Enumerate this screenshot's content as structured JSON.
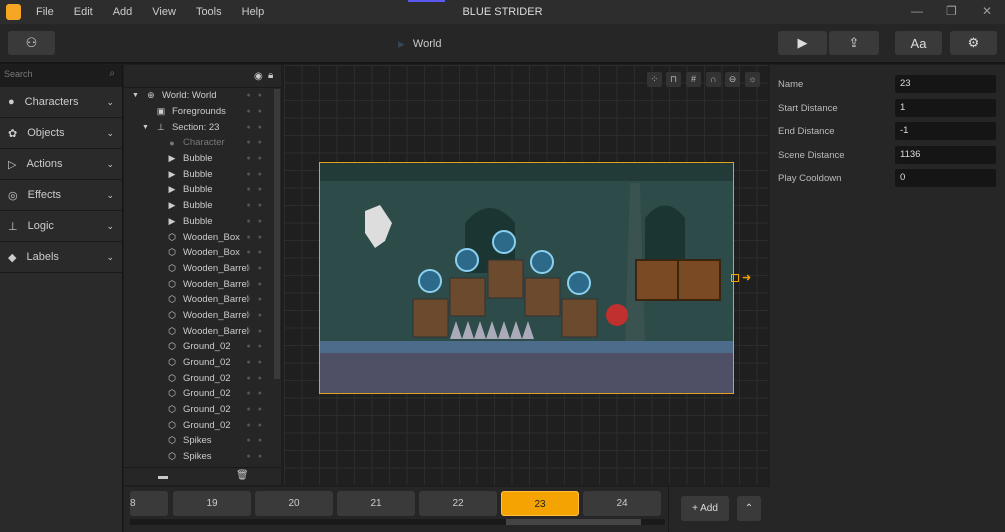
{
  "app": {
    "title": "BLUE STRIDER",
    "menu": [
      "File",
      "Edit",
      "Add",
      "View",
      "Tools",
      "Help"
    ]
  },
  "toolbar": {
    "breadcrumb": "World",
    "font_label": "Aa"
  },
  "sidebar": {
    "search_placeholder": "Search",
    "categories": [
      "Characters",
      "Objects",
      "Actions",
      "Effects",
      "Logic",
      "Labels"
    ]
  },
  "tree": {
    "items": [
      {
        "label": "World: World",
        "icon": "globe-icon",
        "indent": 0,
        "arrow": true
      },
      {
        "label": "Foregrounds",
        "icon": "image-icon",
        "indent": 1,
        "arrow": false
      },
      {
        "label": "Section: 23",
        "icon": "stamp-icon",
        "indent": 1,
        "arrow": true
      },
      {
        "label": "Character",
        "icon": "person-icon",
        "indent": 2,
        "dim": true
      },
      {
        "label": "Bubble",
        "icon": "play-icon",
        "indent": 2
      },
      {
        "label": "Bubble",
        "icon": "play-icon",
        "indent": 2
      },
      {
        "label": "Bubble",
        "icon": "play-icon",
        "indent": 2
      },
      {
        "label": "Bubble",
        "icon": "play-icon",
        "indent": 2
      },
      {
        "label": "Bubble",
        "icon": "play-icon",
        "indent": 2
      },
      {
        "label": "Wooden_Box",
        "icon": "hexagon-icon",
        "indent": 2
      },
      {
        "label": "Wooden_Box",
        "icon": "hexagon-icon",
        "indent": 2
      },
      {
        "label": "Wooden_Barrel",
        "icon": "hexagon-icon",
        "indent": 2
      },
      {
        "label": "Wooden_Barrel",
        "icon": "hexagon-icon",
        "indent": 2
      },
      {
        "label": "Wooden_Barrel",
        "icon": "hexagon-icon",
        "indent": 2
      },
      {
        "label": "Wooden_Barrel",
        "icon": "hexagon-icon",
        "indent": 2
      },
      {
        "label": "Wooden_Barrel",
        "icon": "hexagon-icon",
        "indent": 2
      },
      {
        "label": "Ground_02",
        "icon": "hexagon-icon",
        "indent": 2
      },
      {
        "label": "Ground_02",
        "icon": "hexagon-icon",
        "indent": 2
      },
      {
        "label": "Ground_02",
        "icon": "hexagon-icon",
        "indent": 2
      },
      {
        "label": "Ground_02",
        "icon": "hexagon-icon",
        "indent": 2
      },
      {
        "label": "Ground_02",
        "icon": "hexagon-icon",
        "indent": 2
      },
      {
        "label": "Ground_02",
        "icon": "hexagon-icon",
        "indent": 2
      },
      {
        "label": "Spikes",
        "icon": "hexagon-icon",
        "indent": 2
      },
      {
        "label": "Spikes",
        "icon": "hexagon-icon",
        "indent": 2
      }
    ]
  },
  "properties": [
    {
      "label": "Name",
      "value": "23"
    },
    {
      "label": "Start Distance",
      "value": "1"
    },
    {
      "label": "End Distance",
      "value": "-1"
    },
    {
      "label": "Scene Distance",
      "value": "1136"
    },
    {
      "label": "Play Cooldown",
      "value": "0"
    }
  ],
  "sections": {
    "items": [
      "8",
      "19",
      "20",
      "21",
      "22",
      "23",
      "24"
    ],
    "active": "23",
    "add_label": "+ Add",
    "scroll_position": 0.75
  },
  "colors": {
    "accent": "#f5a300",
    "scene_bg": "#2c4b49"
  }
}
